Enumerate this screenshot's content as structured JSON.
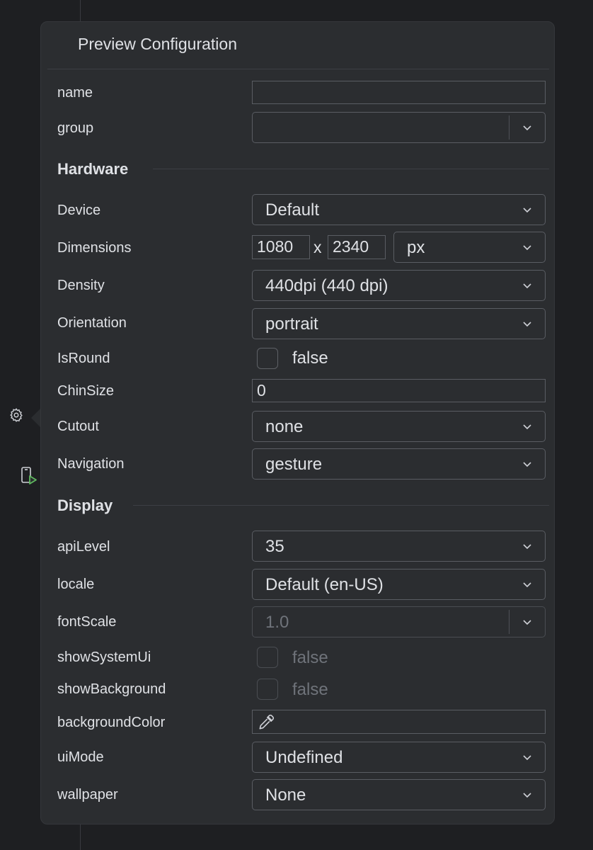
{
  "title": "Preview Configuration",
  "fields": {
    "name": {
      "label": "name",
      "value": ""
    },
    "group": {
      "label": "group",
      "value": ""
    },
    "device": {
      "label": "Device",
      "value": "Default"
    },
    "dimensions": {
      "label": "Dimensions",
      "width": "1080",
      "separator": "x",
      "height": "2340",
      "unit": "px"
    },
    "density": {
      "label": "Density",
      "value": "440dpi (440 dpi)"
    },
    "orientation": {
      "label": "Orientation",
      "value": "portrait"
    },
    "isRound": {
      "label": "IsRound",
      "checked": false,
      "text": "false"
    },
    "chinSize": {
      "label": "ChinSize",
      "value": "0"
    },
    "cutout": {
      "label": "Cutout",
      "value": "none"
    },
    "navigation": {
      "label": "Navigation",
      "value": "gesture"
    },
    "apiLevel": {
      "label": "apiLevel",
      "value": "35"
    },
    "locale": {
      "label": "locale",
      "value": "Default (en-US)"
    },
    "fontScale": {
      "label": "fontScale",
      "value": "1.0",
      "enabled": false
    },
    "showSystemUi": {
      "label": "showSystemUi",
      "checked": false,
      "text": "false",
      "enabled": false
    },
    "showBackground": {
      "label": "showBackground",
      "checked": false,
      "text": "false",
      "enabled": false
    },
    "backgroundColor": {
      "label": "backgroundColor",
      "icon": "eyedropper-icon"
    },
    "uiMode": {
      "label": "uiMode",
      "value": "Undefined"
    },
    "wallpaper": {
      "label": "wallpaper",
      "value": "None"
    }
  },
  "sections": {
    "hardware": "Hardware",
    "display": "Display"
  },
  "gutter": {
    "settings_icon": "gear-icon",
    "run_preview_icon": "run-preview-icon"
  },
  "colors": {
    "panel_bg": "#2b2d30",
    "editor_bg": "#1e1f22",
    "run_accent": "#5fb85f"
  }
}
